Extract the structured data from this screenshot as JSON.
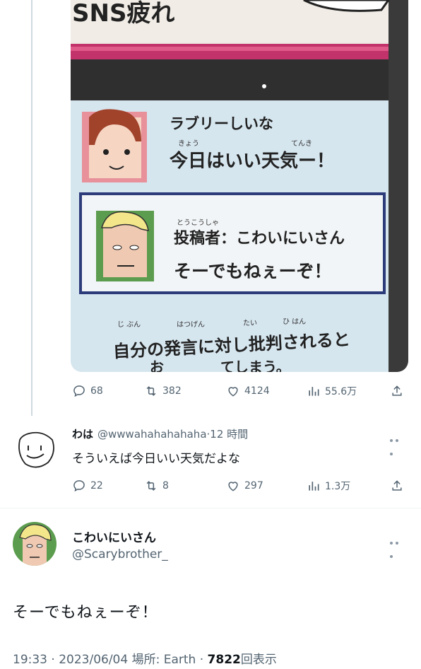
{
  "photo": {
    "header_partial": "SNS疲れ",
    "poster1_name": "ラブリーしいな",
    "poster1_text": "今日はいい天気ー！",
    "poster1_ruby_kyou": "きょう",
    "poster1_ruby_tenki": "てんき",
    "poster2_ruby": "とうこうしゃ",
    "poster2_label": "投稿者：こわいにいさん",
    "poster2_text": "そーでもねぇーぞ！",
    "caption_ruby_1": "じ ぶん",
    "caption_ruby_2": "はつげん",
    "caption_ruby_3": "たい",
    "caption_ruby_4": "ひ はん",
    "caption": "自分の発言に対し批判されると",
    "caption_partial": "お　　　　てしまう。"
  },
  "original_tweet_actions": {
    "replies": "68",
    "retweets": "382",
    "likes": "4124",
    "views": "55.6万"
  },
  "reply": {
    "name": "わは",
    "handle": "@wwwahahahahaha",
    "dot": "·",
    "time": "12 時間",
    "text": "そういえば今日いい天気だよな",
    "actions": {
      "replies": "22",
      "retweets": "8",
      "likes": "297",
      "views": "1.3万"
    }
  },
  "main_tweet": {
    "name": "こわいにいさん",
    "handle": "@Scarybrother_",
    "text": "そーでもねぇーぞ！",
    "meta_time": "19:33 · 2023/06/04 場所: Earth ·",
    "meta_views": "7822",
    "meta_views_label": "回表示"
  },
  "colors": {
    "text": "#0f1419",
    "muted": "#536471",
    "thread_line": "#cfd9de",
    "divider": "#eff3f4",
    "manga_bubble": "#d6e6ef",
    "manga_frame": "#2c3b7a",
    "manga_pink": "#c2336b"
  },
  "icons": [
    "reply-icon",
    "retweet-icon",
    "like-icon",
    "views-icon",
    "share-icon",
    "more-icon"
  ]
}
